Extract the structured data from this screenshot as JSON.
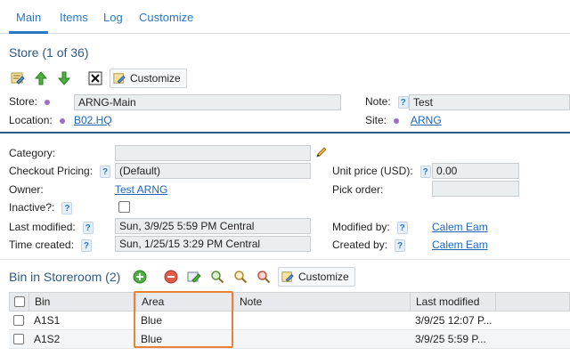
{
  "tabs": [
    {
      "label": "Main"
    },
    {
      "label": "Items"
    },
    {
      "label": "Log"
    },
    {
      "label": "Customize"
    }
  ],
  "store_section": {
    "title": "Store (1 of 36)",
    "customize_label": "Customize",
    "fields": {
      "store_label": "Store:",
      "store_value": "ARNG-Main",
      "note_label": "Note:",
      "note_value": "Test",
      "location_label": "Location:",
      "location_value": "B02.HQ",
      "site_label": "Site:",
      "site_value": "ARNG"
    }
  },
  "details": {
    "category_label": "Category:",
    "category_value": "",
    "checkout_pricing_label": "Checkout Pricing:",
    "checkout_pricing_value": "(Default)",
    "unit_price_label": "Unit price (USD):",
    "unit_price_value": "0.00",
    "owner_label": "Owner:",
    "owner_value": "Test ARNG",
    "pick_order_label": "Pick order:",
    "pick_order_value": "",
    "inactive_label": "Inactive?:",
    "inactive_checked": false,
    "last_modified_label": "Last modified:",
    "last_modified_value": "Sun, 3/9/25 5:59 PM Central",
    "modified_by_label": "Modified by:",
    "modified_by_value": "Calem Eam",
    "time_created_label": "Time created:",
    "time_created_value": "Sun, 1/25/15 3:29 PM Central",
    "created_by_label": "Created by:",
    "created_by_value": "Calem Eam"
  },
  "bins": {
    "title": "Bin in Storeroom (2)",
    "customize_label": "Customize",
    "columns": [
      "Bin",
      "Area",
      "Note",
      "Last modified"
    ],
    "rows": [
      {
        "bin": "A1S1",
        "area": "Blue",
        "note": "",
        "last_modified": "3/9/25 12:07 P..."
      },
      {
        "bin": "A1S2",
        "area": "Blue",
        "note": "",
        "last_modified": "3/9/25 5:59 P..."
      }
    ]
  },
  "colors": {
    "accent": "#2a78c2",
    "section_title": "#2e5a86",
    "link": "#1f66b8",
    "required_dot": "#9b6fc9",
    "highlight_box": "#e8823a",
    "field_bg": "#ebeeef"
  },
  "icons": {
    "store_toolbar": [
      "edit-record-icon",
      "move-up-icon",
      "move-down-icon",
      "delete-icon",
      "customize-icon"
    ],
    "bin_toolbar": [
      "add-icon",
      "remove-icon",
      "edit-bin-icon",
      "search-icon",
      "zoom-icon",
      "clear-search-icon",
      "customize-icon"
    ]
  }
}
